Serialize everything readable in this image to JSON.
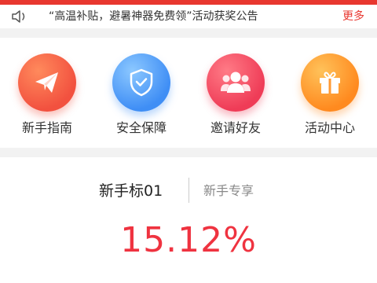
{
  "notice": {
    "icon": "speaker-icon",
    "text": "“高温补贴，避暑神器免费领”活动获奖公告",
    "more_label": "更多"
  },
  "menu": {
    "items": [
      {
        "label": "新手指南",
        "icon": "paper-plane-icon",
        "color": "#f2513f"
      },
      {
        "label": "安全保障",
        "icon": "shield-check-icon",
        "color": "#3f8ef5"
      },
      {
        "label": "邀请好友",
        "icon": "people-icon",
        "color": "#ef3c57"
      },
      {
        "label": "活动中心",
        "icon": "gift-icon",
        "color": "#ff8a1f"
      }
    ]
  },
  "product": {
    "name": "新手标01",
    "tag": "新手专享",
    "rate": "15.12%"
  },
  "colors": {
    "accent": "#e8372f",
    "rate": "#ef3340"
  }
}
